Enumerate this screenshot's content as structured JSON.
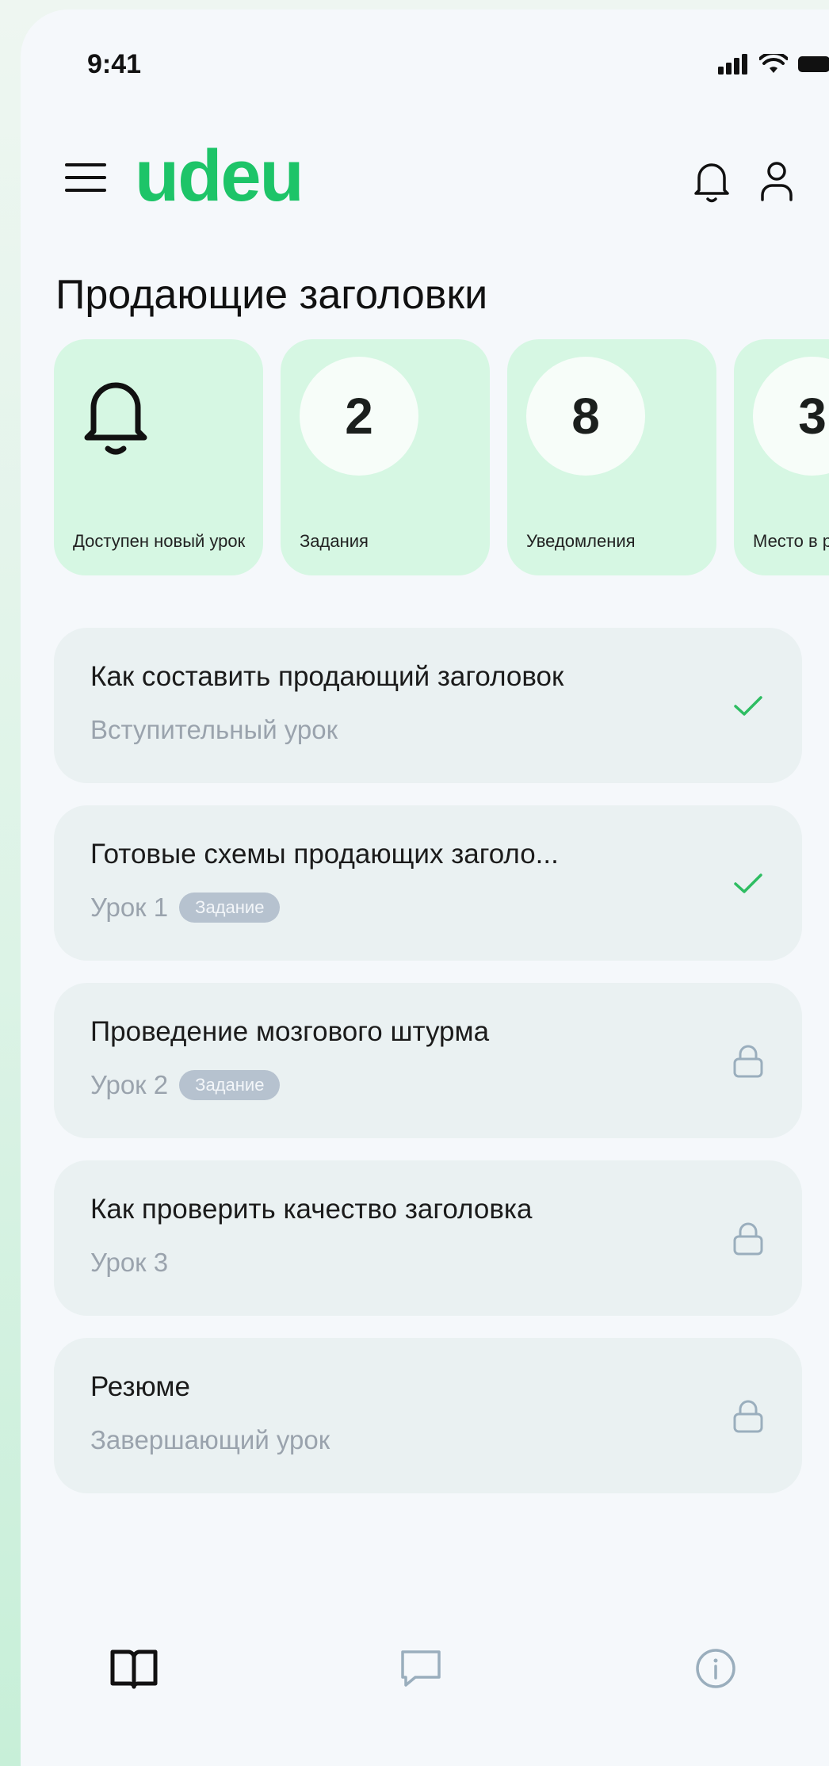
{
  "status_bar": {
    "time": "9:41"
  },
  "header": {
    "logo": "udeu"
  },
  "page_title": "Продающие заголовки",
  "cards": [
    {
      "label": "Доступен новый урок",
      "icon": "bell-icon"
    },
    {
      "value": "2",
      "label": "Задания"
    },
    {
      "value": "8",
      "label": "Уведомления"
    },
    {
      "value": "3",
      "label": "Место в рейтинге"
    }
  ],
  "lessons": [
    {
      "title": "Как составить продающий заголовок",
      "subtitle": "Вступительный урок",
      "badge": "",
      "status": "done"
    },
    {
      "title": "Готовые схемы продающих заголо...",
      "subtitle": "Урок 1",
      "badge": "Задание",
      "status": "done"
    },
    {
      "title": "Проведение мозгового штурма",
      "subtitle": "Урок 2",
      "badge": "Задание",
      "status": "locked"
    },
    {
      "title": "Как проверить качество заголовка",
      "subtitle": "Урок 3",
      "badge": "",
      "status": "locked"
    },
    {
      "title": "Резюме",
      "subtitle": "Завершающий урок",
      "badge": "",
      "status": "locked"
    }
  ],
  "colors": {
    "accent": "#1dc468",
    "card_bg": "#d6f7e3",
    "lesson_bg": "#eaf1f2",
    "check": "#2ebd62",
    "lock": "#9aaebd"
  },
  "tabbar": [
    "book-icon",
    "chat-icon",
    "info-icon"
  ]
}
